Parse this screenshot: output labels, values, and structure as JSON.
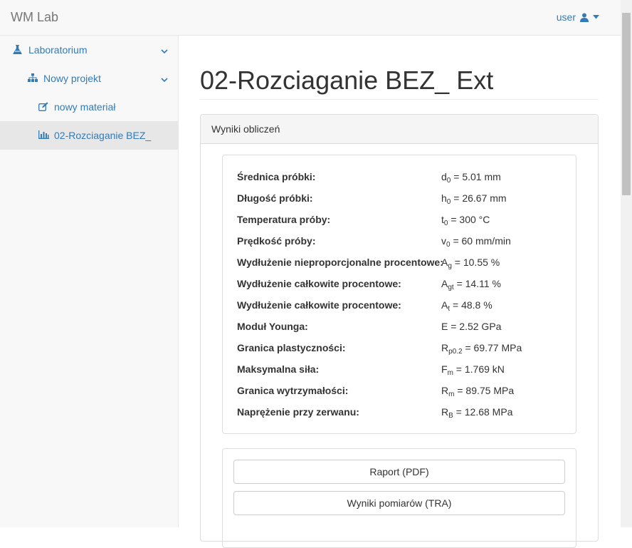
{
  "app": {
    "brand": "WM Lab"
  },
  "user_menu": {
    "label": "user",
    "icons": [
      "user-icon",
      "caret-down-icon"
    ]
  },
  "sidebar": {
    "items": [
      {
        "label": "Laboratorium",
        "icon": "flask-icon",
        "expanded": true
      },
      {
        "label": "Nowy projekt",
        "icon": "sitemap-icon",
        "expanded": true
      },
      {
        "label": "nowy materiał",
        "icon": "edit-icon"
      },
      {
        "label": "02-Rozciaganie BEZ_",
        "icon": "bar-chart-icon",
        "active": true
      }
    ]
  },
  "page": {
    "title": "02-Rozciaganie BEZ_ Ext"
  },
  "panel": {
    "heading": "Wyniki obliczeń"
  },
  "results": [
    {
      "label": "Średnica próbki:",
      "sym": "d",
      "sub": "0",
      "rest": " = 5.01 mm"
    },
    {
      "label": "Długość próbki:",
      "sym": "h",
      "sub": "0",
      "rest": " = 26.67 mm"
    },
    {
      "label": "Temperatura próby:",
      "sym": "t",
      "sub": "0",
      "rest": " = 300 °C"
    },
    {
      "label": "Prędkość próby:",
      "sym": "v",
      "sub": "0",
      "rest": " = 60 mm/min"
    },
    {
      "label": "Wydłużenie nieproporcjonalne procentowe:",
      "sym": "A",
      "sub": "g",
      "rest": " = 10.55 %"
    },
    {
      "label": "Wydłużenie całkowite procentowe:",
      "sym": "A",
      "sub": "gt",
      "rest": " = 14.11 %"
    },
    {
      "label": "Wydłużenie całkowite procentowe:",
      "sym": "A",
      "sub": "t",
      "rest": " = 48.8 %"
    },
    {
      "label": "Moduł Younga:",
      "sym": "E",
      "sub": "",
      "rest": " = 2.52 GPa"
    },
    {
      "label": "Granica plastyczności:",
      "sym": "R",
      "sub": "p0.2",
      "rest": " = 69.77 MPa"
    },
    {
      "label": "Maksymalna siła:",
      "sym": "F",
      "sub": "m",
      "rest": " = 1.769 kN"
    },
    {
      "label": "Granica wytrzymałości:",
      "sym": "R",
      "sub": "m",
      "rest": " = 89.75 MPa"
    },
    {
      "label": "Naprężenie przy zerwanu:",
      "sym": "R",
      "sub": "B",
      "rest": " = 12.68 MPa"
    }
  ],
  "buttons": {
    "report_pdf": "Raport (PDF)",
    "results_tra": "Wyniki pomiarów (TRA)"
  }
}
